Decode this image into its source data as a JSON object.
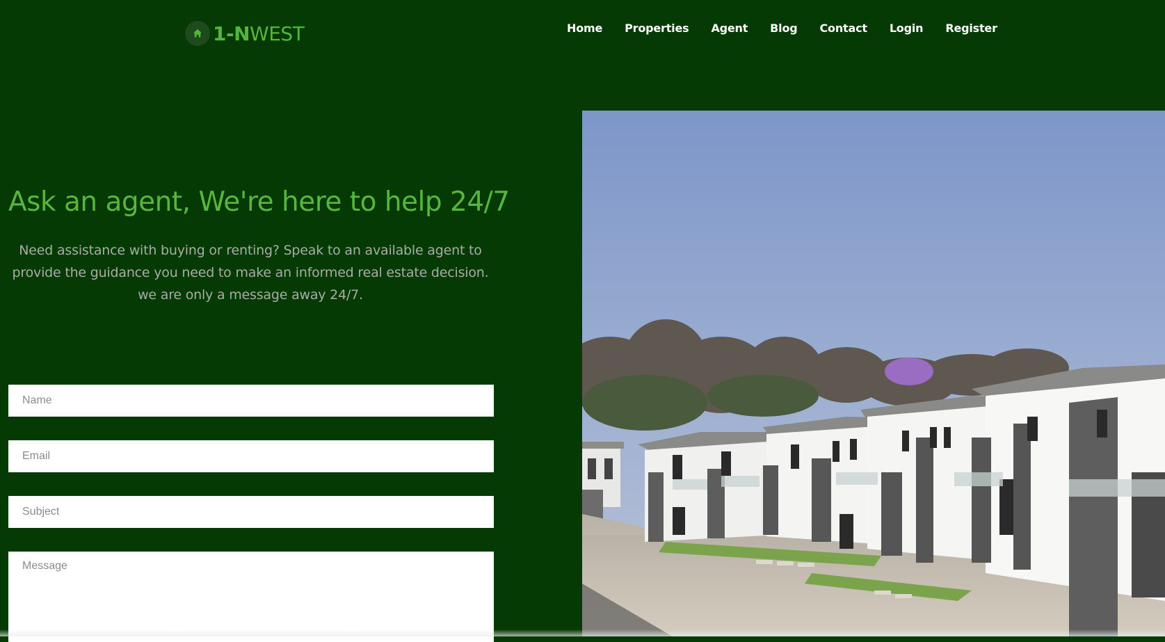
{
  "brand": {
    "name_strong": "1-N",
    "name_light": "WEST",
    "icon": "home-icon"
  },
  "nav": [
    {
      "label": "Home"
    },
    {
      "label": "Properties"
    },
    {
      "label": "Agent"
    },
    {
      "label": "Blog"
    },
    {
      "label": "Contact"
    },
    {
      "label": "Login"
    },
    {
      "label": "Register"
    }
  ],
  "hero": {
    "headline": "Ask an agent, We're here to help 24/7",
    "description": "Need assistance with buying or renting? Speak to an available agent to provide the guidance you need to make an informed real estate decision. we are only a message away 24/7."
  },
  "form": {
    "name_placeholder": "Name",
    "email_placeholder": "Email",
    "subject_placeholder": "Subject",
    "message_placeholder": "Message"
  },
  "colors": {
    "background": "#063a05",
    "accent": "#58b53e",
    "nav_text": "#ffffff",
    "body_text": "#a5aea2"
  }
}
